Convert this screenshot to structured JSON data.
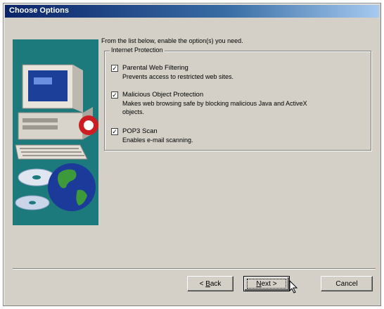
{
  "window": {
    "title": "Choose Options"
  },
  "intro_text": "From the list below, enable the option(s) you need.",
  "group": {
    "label": "Internet Protection",
    "options": [
      {
        "label": "Parental Web Filtering",
        "description": [
          "Prevents access to restricted web sites."
        ],
        "checked": true
      },
      {
        "label": "Malicious Object Protection",
        "description": [
          "Makes web browsing safe by blocking malicious Java and ActiveX",
          "objects."
        ],
        "checked": true
      },
      {
        "label": "POP3 Scan",
        "description": [
          "Enables e-mail scanning."
        ],
        "checked": true
      }
    ]
  },
  "buttons": {
    "back_prefix": "< ",
    "back_key": "B",
    "back_rest": "ack",
    "next_key": "N",
    "next_rest": "ext >",
    "cancel": "Cancel"
  },
  "colors": {
    "title_bar": "#0a246a",
    "dialog_face": "#d4d0c8",
    "art_background": "#1d7a7c"
  }
}
